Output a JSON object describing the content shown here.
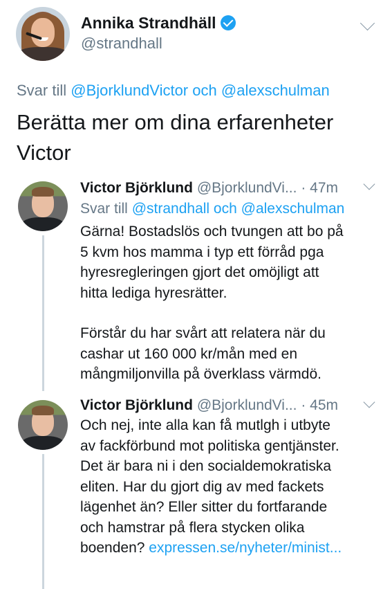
{
  "original_tweet": {
    "display_name": "Annika Strandhäll",
    "handle": "@strandhall",
    "reply_prefix": "Svar till",
    "reply_user1": "@BjorklundVictor",
    "reply_conj": "och",
    "reply_user2": "@alexschulman",
    "text_line1": "Berätta mer om dina erfarenheter",
    "text_line2": "Victor"
  },
  "replies": [
    {
      "display_name": "Victor Björklund",
      "handle": "@BjorklundVi...",
      "time": "· 47m",
      "reply_prefix": "Svar till",
      "reply_user1": "@strandhall",
      "reply_conj": "och",
      "reply_user2": "@alexschulman",
      "lines": [
        "Gärna! Bostadslös och tvungen att bo på",
        "5 kvm hos mamma i typ ett förråd pga",
        "hyresregleringen gjort det omöjligt att",
        "hitta lediga hyresrätter.",
        "Förstår du har svårt att relatera när du",
        "cashar ut 160 000 kr/mån med en",
        "mångmiljonvilla på överklass värmdö."
      ]
    },
    {
      "display_name": "Victor Björklund",
      "handle": "@BjorklundVi...",
      "time": "· 45m",
      "lines": [
        "Och nej, inte alla kan få mutlgh i utbyte",
        "av fackförbund mot politiska gentjänster.",
        "Det är bara ni i den socialdemokratiska",
        "eliten. Har du gjort dig av med fackets",
        "lägenhet än? Eller sitter du fortfarande",
        "och hamstrar på flera stycken olika",
        "boenden?"
      ],
      "link": "expressen.se/nyheter/minist..."
    }
  ],
  "colors": {
    "link": "#1da1f2",
    "secondary_text": "#657786",
    "primary_text": "#14171a",
    "thread_line": "#ccd6dd"
  }
}
